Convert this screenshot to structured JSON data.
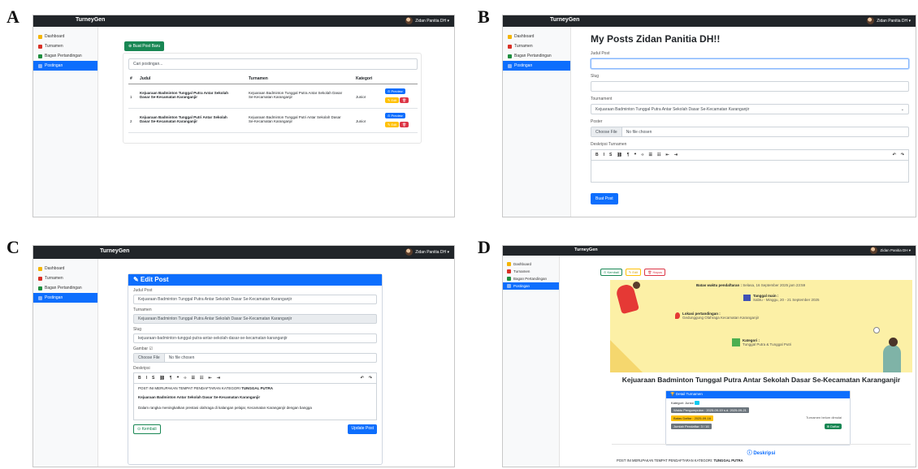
{
  "panels": {
    "a": {
      "letter": "A"
    },
    "b": {
      "letter": "B"
    },
    "c": {
      "letter": "C"
    },
    "d": {
      "letter": "D"
    }
  },
  "app": {
    "brand": "TurneyGen",
    "user": "Zidan Panitia DH ▾"
  },
  "sidebar": {
    "dashboard": "Dashboard",
    "turnamen": "Turnamen",
    "bagan": "Bagan Pertandingan",
    "postingan": "Postingan"
  },
  "panel_a": {
    "new_button": "⊕ Buat Post Baru",
    "search_placeholder": "Cari postingan...",
    "headers": [
      "#",
      "Judul",
      "Turnamen",
      "Kategori"
    ],
    "rows": [
      {
        "no": "1",
        "judul": "Kejuaraan Badminton Tunggal Putra Antar Sekolah Dasar Se-Kecamatan Karanganjir",
        "turnamen": "Kejuaraan Badminton Tunggal Putra Antar Sekolah Dasar Se-Kecamatan Karanganjir",
        "kategori": "Junior"
      },
      {
        "no": "2",
        "judul": "Kejuaraan Badminton Tunggal Putri Antar Sekolah Dasar Se-Kecamatan Karanganjir",
        "turnamen": "Kejuaraan Badminton Tunggal Putri Antar Sekolah Dasar Se-Kecamatan Karanganjir",
        "kategori": "Junior"
      }
    ],
    "preview_label": "⊙ Preview",
    "edit_label": "✎ Edit"
  },
  "panel_b": {
    "title": "My Posts Zidan Panitia DH!!",
    "judul_label": "Judul Post",
    "slug_label": "Slug",
    "tournament_label": "Tournament",
    "tournament_value": "Kejuaraan Badminton Tunggal Putra Antar Sekolah Dasar Se-Kecamatan Karanganjir",
    "poster_label": "Poster",
    "choose_file": "Choose File",
    "no_file": "No file chosen",
    "deskripsi_label": "Deskripsi Turnamen",
    "submit": "Buat Post"
  },
  "panel_c": {
    "header": "✎ Edit Post",
    "judul_label": "Judul Post",
    "judul_value": "Kejuaraan Badminton Tunggal Putra Antar Sekolah Dasar Se-Kecamatan Karanganjir",
    "turnamen_label": "Turnamen",
    "turnamen_value": "Kejuaraan Badminton Tunggal Putra Antar Sekolah Dasar Se-Kecamatan Karanganjir",
    "slug_label": "Slug",
    "slug_value": "kejuaraan-badminton-tunggal-putra-antar-sekolah-dasar-se-kecamatan-karanganjir",
    "gambar_label": "Gambar ☑",
    "choose_file": "Choose File",
    "no_file": "No file chosen",
    "deskripsi_label": "Deskripsi",
    "editor_line1_a": "POST INI MERUPAKAN TEMPAT PENDAFTARAN KATEGORI ",
    "editor_line1_b": "TUNGGAL PUTRA",
    "editor_line2": "Kejuaraan Badminton Antar Sekolah Dasar Se-Kecamatan Karanganjir",
    "editor_line3": "Dalam rangka meningkatkan prestasi olahraga di kalangan pelajar, Kecamatan Karanganjir dengan bangga",
    "back": "⊙ Kembali",
    "update": "Update Post"
  },
  "panel_d": {
    "back": "⊙ Kembali",
    "edit": "✎ Edit",
    "hapus": "🗑 Hapus",
    "batas_label": "Batas waktu pendaftaran :",
    "batas_value": "Selasa, 16 September 2025 jam 23:59",
    "tanggal_label": "Tanggal main :",
    "tanggal_value": "Sabtu - Minggu, 20 - 21 September 2025",
    "lokasi_label": "Lokasi pertandingan :",
    "lokasi_value": "Gedunggung Olahraga Kecamatan Karanganjir",
    "kategori_label": "Kategori :",
    "kategori_value": "Tunggal Putra & Tunggal Putri",
    "title": "Kejuaraan Badminton Tunggal Putra Antar Sekolah Dasar Se-Kecamatan Karanganjir",
    "detail_header": "🏆 Detail Turnamen",
    "kategori_junior": "Kategori: Junior",
    "badge1": "Waktu Pengumpulan : 2025-09-19 s.d. 2025-09-21",
    "badge2": "Batas Daftar : 2025-09-16",
    "badge3": "Jumlah Pendaftar: 3 / 16",
    "turnamen_status": "Turnamen belum dimulai",
    "daftar": "⊕ Daftar",
    "deskripsi_heading": "ⓘ Deskripsi",
    "deskripsi_line_a": "POST INI MERUPAKAN TEMPAT PENDAFTARAN KATEGORI: ",
    "deskripsi_line_b": "TUNGGAL PUTRA"
  }
}
